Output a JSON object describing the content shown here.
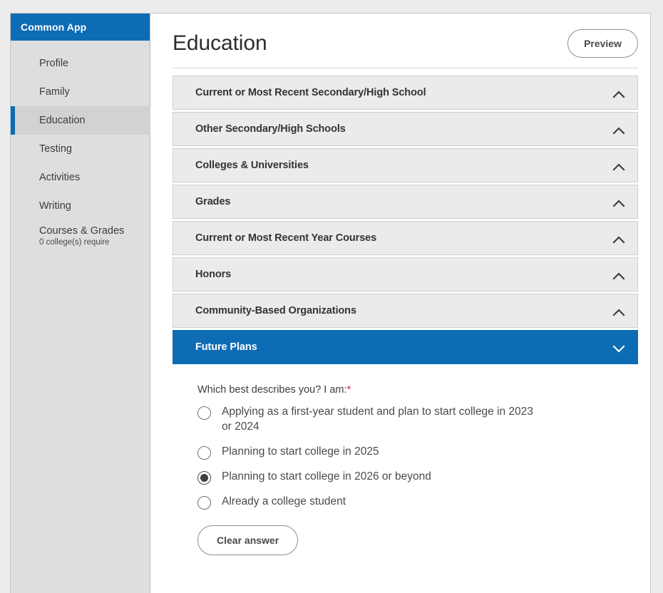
{
  "sidebar": {
    "brand": "Common App",
    "items": [
      {
        "label": "Profile",
        "sub": "",
        "active": false
      },
      {
        "label": "Family",
        "sub": "",
        "active": false
      },
      {
        "label": "Education",
        "sub": "",
        "active": true
      },
      {
        "label": "Testing",
        "sub": "",
        "active": false
      },
      {
        "label": "Activities",
        "sub": "",
        "active": false
      },
      {
        "label": "Writing",
        "sub": "",
        "active": false
      },
      {
        "label": "Courses & Grades",
        "sub": "0 college(s) require",
        "active": false
      }
    ]
  },
  "header": {
    "title": "Education",
    "preview_label": "Preview"
  },
  "accordion": {
    "sections": [
      {
        "title": "Current or Most Recent Secondary/High School",
        "open": false,
        "icon": "chevron-up-icon"
      },
      {
        "title": "Other Secondary/High Schools",
        "open": false,
        "icon": "chevron-up-icon"
      },
      {
        "title": "Colleges & Universities",
        "open": false,
        "icon": "chevron-up-icon"
      },
      {
        "title": "Grades",
        "open": false,
        "icon": "chevron-up-icon"
      },
      {
        "title": "Current or Most Recent Year Courses",
        "open": false,
        "icon": "chevron-up-icon"
      },
      {
        "title": "Honors",
        "open": false,
        "icon": "chevron-up-icon"
      },
      {
        "title": "Community-Based Organizations",
        "open": false,
        "icon": "chevron-up-icon"
      },
      {
        "title": "Future Plans",
        "open": true,
        "icon": "chevron-down-icon"
      }
    ]
  },
  "future_plans": {
    "question": "Which best describes you? I am:",
    "required_marker": "*",
    "options": [
      {
        "label": "Applying as a first-year student and plan to start college in 2023 or 2024",
        "checked": false
      },
      {
        "label": "Planning to start college in 2025",
        "checked": false
      },
      {
        "label": "Planning to start college in 2026 or beyond",
        "checked": true
      },
      {
        "label": "Already a college student",
        "checked": false
      }
    ],
    "clear_label": "Clear answer"
  },
  "colors": {
    "brand_blue": "#0e6cb5",
    "required_red": "#e0263c",
    "sidebar_bg": "#dedede",
    "accordion_bg": "#ebebeb",
    "page_bg": "#ececec"
  }
}
